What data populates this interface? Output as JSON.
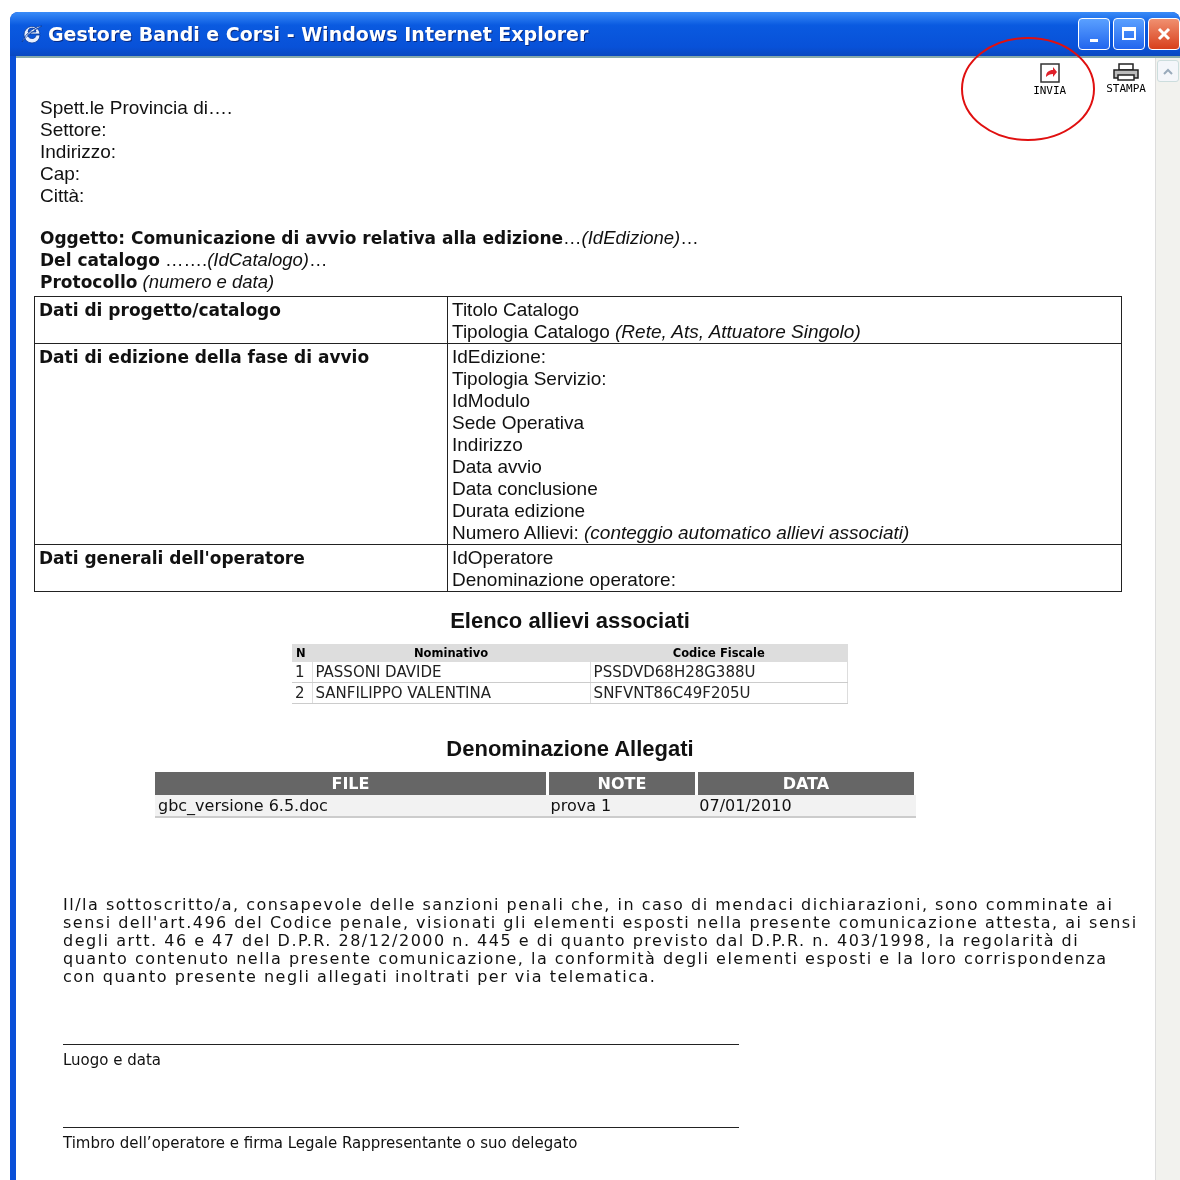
{
  "window": {
    "title": "Gestore Bandi e Corsi - Windows Internet Explorer"
  },
  "toolbar": [
    {
      "label": "INVIA",
      "kind": "send"
    },
    {
      "label": "STAMPA",
      "kind": "print"
    }
  ],
  "address_lines": [
    "Spett.le  Provincia di….",
    "Settore:",
    "Indirizzo:",
    "Cap:",
    "Città:"
  ],
  "subject_lines": [
    "**Oggetto: Comunicazione di avvio relativa alla edizione**…*(IdEdizione)*…",
    "**Del catalogo** …….*(IdCatalogo)*…",
    "**Protocollo** *(numero e data)*"
  ],
  "info_table": [
    {
      "label": "Dati di progetto/catalogo",
      "lines": [
        "Titolo Catalogo",
        "Tipologia Catalogo *(Rete, Ats, Attuatore Singolo)*"
      ]
    },
    {
      "label": "Dati di edizione della fase di avvio",
      "lines": [
        "IdEdizione:",
        "Tipologia Servizio:",
        "IdModulo",
        "Sede Operativa",
        "Indirizzo",
        "Data avvio",
        "Data conclusione",
        "Durata edizione",
        "Numero Allievi:  *(conteggio automatico allievi associati)*"
      ]
    },
    {
      "label": "Dati generali dell'operatore",
      "lines": [
        "IdOperatore",
        "Denominazione operatore:"
      ]
    }
  ],
  "students": {
    "title": "Elenco allievi associati",
    "columns": [
      "N",
      "Nominativo",
      "Codice Fiscale"
    ],
    "rows": [
      [
        "1",
        "PASSONI DAVIDE",
        "PSSDVD68H28G388U"
      ],
      [
        "2",
        "SANFILIPPO VALENTINA",
        "SNFVNT86C49F205U"
      ]
    ]
  },
  "attachments": {
    "title": "Denominazione Allegati",
    "columns": [
      "FILE",
      "NOTE",
      "DATA"
    ],
    "rows": [
      [
        "gbc_versione 6.5.doc",
        "prova 1",
        "07/01/2010"
      ]
    ]
  },
  "declaration": "Il/la sottoscritto/a, consapevole delle sanzioni penali che, in caso di mendaci dichiarazioni, sono comminate ai sensi dell'art.496 del Codice penale, visionati gli elementi esposti nella presente comunicazione attesta, ai sensi degli artt. 46 e 47 del D.P.R. 28/12/2000 n. 445 e di quanto previsto dal D.P.R. n. 403/1998, la regolarità di quanto contenuto nella presente comunicazione, la conformità degli elementi esposti e la loro corrispondenza con quanto presente negli allegati inoltrati per via telematica.",
  "signatures": [
    "Luogo e data",
    "Timbro dell’operatore e firma Legale Rappresentante o suo delegato"
  ]
}
